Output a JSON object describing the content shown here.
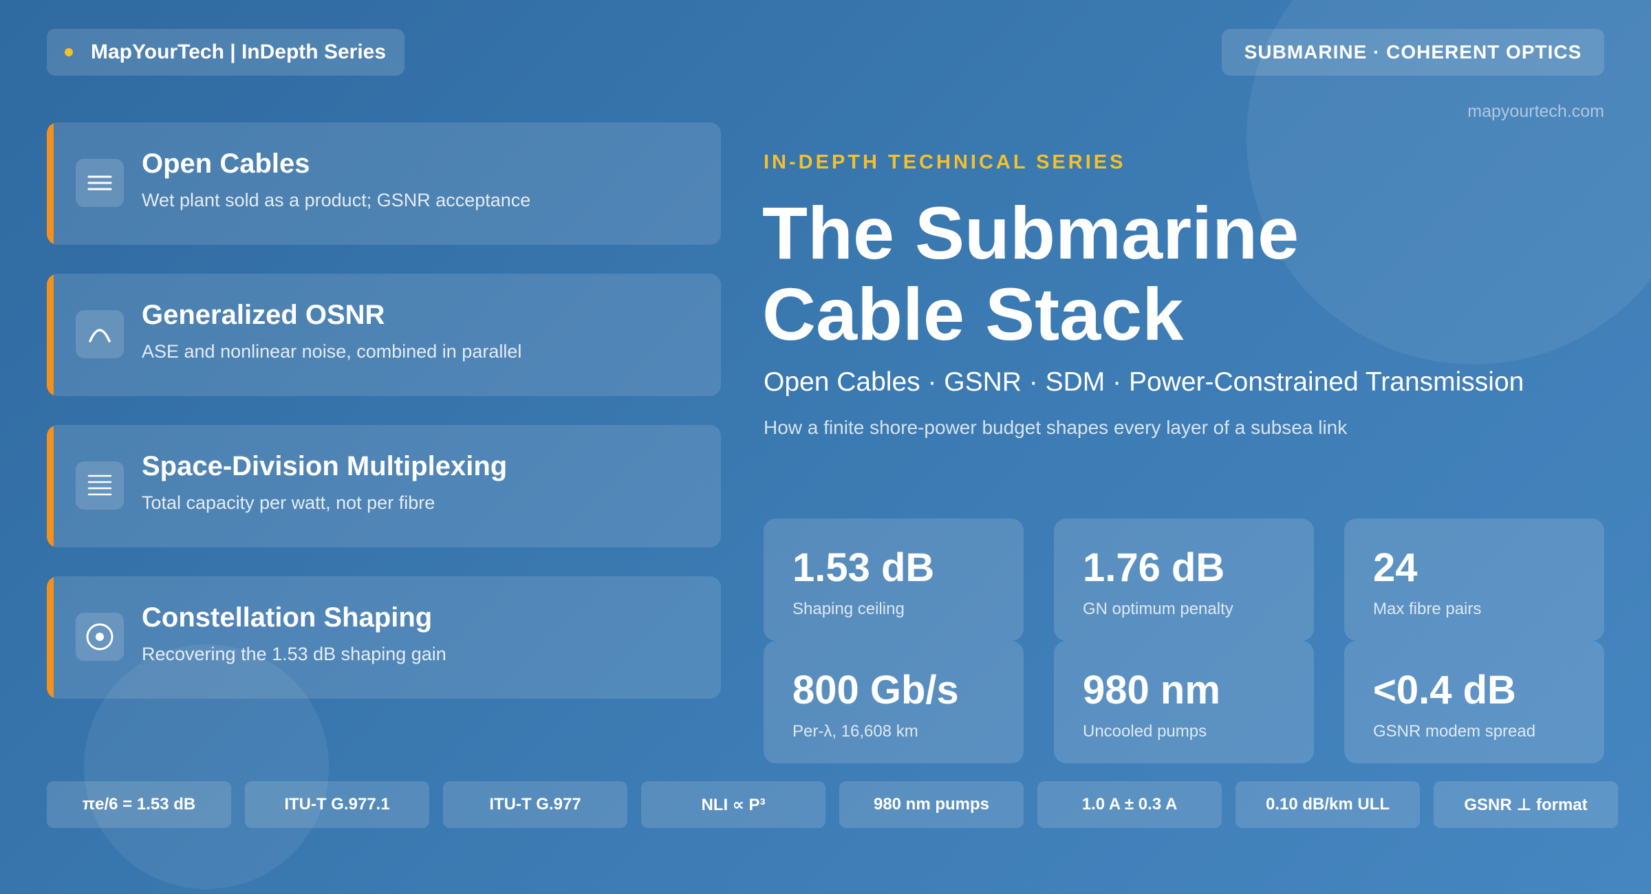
{
  "header": {
    "brand": "MapYourTech | InDepth Series",
    "tag": "SUBMARINE · COHERENT OPTICS",
    "site": "mapyourtech.com",
    "brand_dot_color": "#f5c02a"
  },
  "features": [
    {
      "title": "Open Cables",
      "desc": "Wet plant sold as a product; GSNR acceptance",
      "icon": "menu-lines-icon"
    },
    {
      "title": "Generalized OSNR",
      "desc": "ASE and nonlinear noise, combined in parallel",
      "icon": "peak-curve-icon"
    },
    {
      "title": "Space-Division Multiplexing",
      "desc": "Total capacity per watt, not per fibre",
      "icon": "stacked-lines-icon"
    },
    {
      "title": "Constellation Shaping",
      "desc": "Recovering the 1.53 dB shaping gain",
      "icon": "target-circle-icon"
    }
  ],
  "hero": {
    "eyebrow": "IN-DEPTH TECHNICAL SERIES",
    "title_line1": "The Submarine",
    "title_line2": "Cable Stack",
    "subtitle": "Open Cables · GSNR · SDM · Power-Constrained Transmission",
    "tagline": "How a finite shore-power budget shapes every layer of a subsea link"
  },
  "stats": [
    {
      "value": "1.53 dB",
      "label": "Shaping ceiling"
    },
    {
      "value": "1.76 dB",
      "label": "GN optimum penalty"
    },
    {
      "value": "24",
      "label": "Max fibre pairs"
    },
    {
      "value": "800 Gb/s",
      "label": "Per-λ, 16,608 km"
    },
    {
      "value": "980 nm",
      "label": "Uncooled pumps"
    },
    {
      "value": "<0.4 dB",
      "label": "GSNR modem spread"
    }
  ],
  "chips": [
    "πe/6 = 1.53 dB",
    "ITU-T G.977.1",
    "ITU-T G.977",
    "NLI ∝ P³",
    "980 nm pumps",
    "1.0 A ± 0.3 A",
    "0.10 dB/km ULL",
    "GSNR ⊥ format"
  ],
  "colors": {
    "accent_orange": "#f4901e",
    "accent_yellow": "#f5c02a",
    "background": "#3a78b0"
  }
}
